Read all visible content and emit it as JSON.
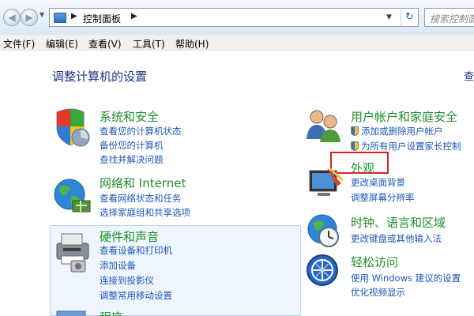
{
  "address_bar": {
    "path": "控制面板",
    "search_placeholder": "搜索控制面板"
  },
  "menu": [
    {
      "label": "文件(F)"
    },
    {
      "label": "编辑(E)"
    },
    {
      "label": "查看(V)"
    },
    {
      "label": "工具(T)"
    },
    {
      "label": "帮助(H)"
    }
  ],
  "main": {
    "title": "调整计算机的设置",
    "view_by": "查"
  },
  "categories": {
    "system_security": {
      "title": "系统和安全",
      "links": [
        "查看您的计算机状态",
        "备份您的计算机",
        "查找并解决问题"
      ]
    },
    "network": {
      "title": "网络和 Internet",
      "links": [
        "查看网络状态和任务",
        "选择家庭组和共享选项"
      ]
    },
    "hardware": {
      "title": "硬件和声音",
      "links": [
        "查看设备和打印机",
        "添加设备",
        "连接到投影仪",
        "调整常用移动设置"
      ]
    },
    "programs": {
      "title": "程序"
    },
    "user_accounts": {
      "title": "用户帐户和家庭安全",
      "links": [
        "添加或删除用户帐户",
        "为所有用户设置家长控制"
      ]
    },
    "appearance": {
      "title": "外观",
      "links": [
        "更改桌面背景",
        "调整屏幕分辨率"
      ]
    },
    "clock": {
      "title": "时钟、语言和区域",
      "links": [
        "更改键盘或其他输入法"
      ]
    },
    "ease": {
      "title": "轻松访问",
      "links": [
        "使用 Windows 建议的设置",
        "优化视频显示"
      ]
    }
  },
  "colors": {
    "category_title": "#1d8d2c",
    "link": "#1f57b8",
    "heading": "#1e3287",
    "highlight_box": "#e02020",
    "hover_background": "#eef5fc"
  }
}
